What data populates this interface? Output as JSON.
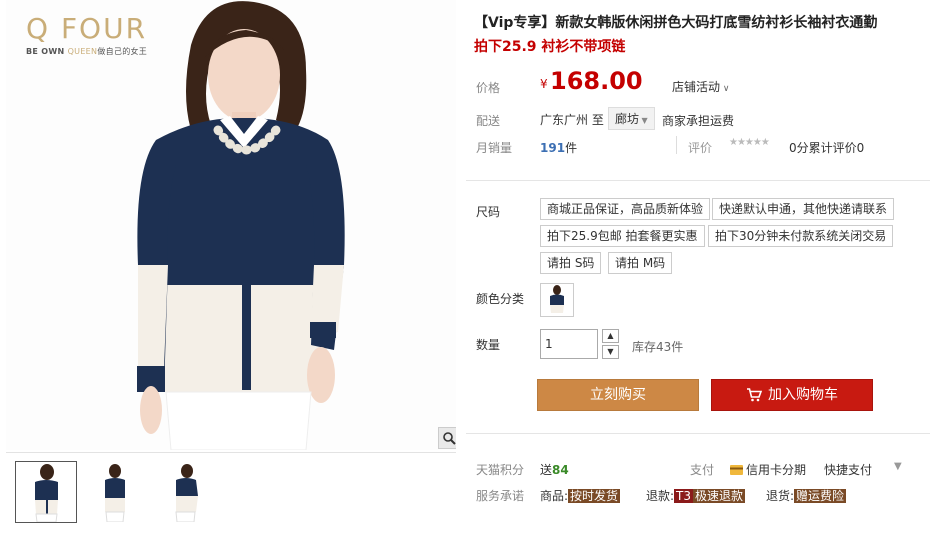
{
  "brand": {
    "logo": "Q FOUR",
    "tagline_prefix": "BE OWN ",
    "tagline_queen": "QUEEN",
    "tagline_cn": "做自己的女王"
  },
  "product": {
    "title": "【Vip专享】新款女韩版休闲拼色大码打底雪纺衬衫长袖衬衣通勤",
    "subtitle": "拍下25.9 衬衫不带项链"
  },
  "price": {
    "label": "价格",
    "currency": "¥",
    "value": "168.00",
    "promo": "店铺活动"
  },
  "shipping": {
    "label": "配送",
    "from": "广东广州 至",
    "dest": "廊坊",
    "note": "商家承担运费"
  },
  "sales": {
    "label": "月销量",
    "count": "191",
    "unit": "件",
    "rating_label": "评价",
    "rating_score": 0,
    "rating_text": "0分累计评价0"
  },
  "size": {
    "label": "尺码",
    "options": [
      "商城正品保证，高品质新体验",
      "快递默认申通，其他快递请联系",
      "拍下25.9包邮 拍套餐更实惠",
      "拍下30分钟未付款系统关闭交易",
      "请拍 S码",
      "请拍 M码"
    ]
  },
  "color": {
    "label": "颜色分类"
  },
  "quantity": {
    "label": "数量",
    "value": "1",
    "stock": "库存43件"
  },
  "actions": {
    "buy_now": "立刻购买",
    "add_cart": "加入购物车"
  },
  "service": {
    "points_label": "天猫积分",
    "points_prefix": "送",
    "points": "84",
    "pay_label": "支付",
    "pay_credit": "信用卡分期",
    "pay_quick": "快捷支付",
    "promise_label": "服务承诺",
    "goods_prefix": "商品:",
    "goods_tag": "按时发货",
    "refund_prefix": "退款:",
    "refund_t3": "T3",
    "refund_tag": "极速退款",
    "return_prefix": "退货:",
    "return_tag": "赠运费险"
  },
  "colors": {
    "accent_red": "#c40000",
    "buy_now": "#cd8845",
    "add_cart": "#c81a11",
    "sales_blue": "#3c6fb3",
    "points_green": "#3a8a28"
  },
  "thumbnails": [
    {
      "name": "thumb-front",
      "active": true
    },
    {
      "name": "thumb-back",
      "active": false
    },
    {
      "name": "thumb-side",
      "active": false
    }
  ]
}
